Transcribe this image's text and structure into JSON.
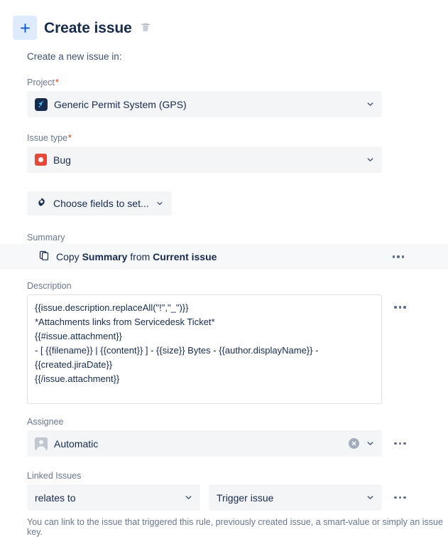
{
  "header": {
    "add_button_icon": "plus-icon",
    "title": "Create issue",
    "delete_icon": "trash-icon"
  },
  "intro": "Create a new issue in:",
  "project": {
    "label": "Project",
    "required_marker": "*",
    "icon": "rocket-project-icon",
    "value": "Generic Permit System (GPS)",
    "chevron_icon": "chevron-down-icon",
    "icon_color": "#172b4d"
  },
  "issue_type": {
    "label": "Issue type",
    "required_marker": "*",
    "icon": "bug-icon",
    "value": "Bug",
    "chevron_icon": "chevron-down-icon",
    "icon_color": "#e5493a"
  },
  "choose_fields": {
    "icon": "gear-icon",
    "label": "Choose fields to set...",
    "chevron_icon": "chevron-down-icon"
  },
  "summary": {
    "label": "Summary",
    "icon": "copy-icon",
    "text_prefix": "Copy ",
    "text_bold_1": "Summary",
    "text_middle": " from ",
    "text_bold_2": "Current issue",
    "more_icon": "more-options-icon"
  },
  "description": {
    "label": "Description",
    "value": "{{issue.description.replaceAll(\"!\",\"_\")}}\n*Attachments links from Servicedesk Ticket*\n{{#issue.attachment}}\n- [ {{filename}} | {{content}} ] - {{size}} Bytes - {{author.displayName}} - {{created.jiraDate}}\n{{/issue.attachment}}",
    "more_icon": "more-options-icon"
  },
  "assignee": {
    "label": "Assignee",
    "avatar_icon": "user-avatar-icon",
    "value": "Automatic",
    "clear_icon": "clear-icon",
    "chevron_icon": "chevron-down-icon",
    "more_icon": "more-options-icon"
  },
  "linked_issues": {
    "label": "Linked Issues",
    "link_type_value": "relates to",
    "link_type_chevron": "chevron-down-icon",
    "target_value": "Trigger issue",
    "target_chevron": "chevron-down-icon",
    "more_icon": "more-options-icon",
    "helper_text": "You can link to the issue that triggered this rule, previously created issue, a smart-value or simply an issue key."
  },
  "colors": {
    "accent": "#0052cc",
    "add_button_bg": "#deebff",
    "field_bg": "#f4f5f7",
    "summary_row_bg": "#f7f8fa",
    "label": "#6b778c",
    "text": "#172b4d",
    "required": "#de350b"
  }
}
